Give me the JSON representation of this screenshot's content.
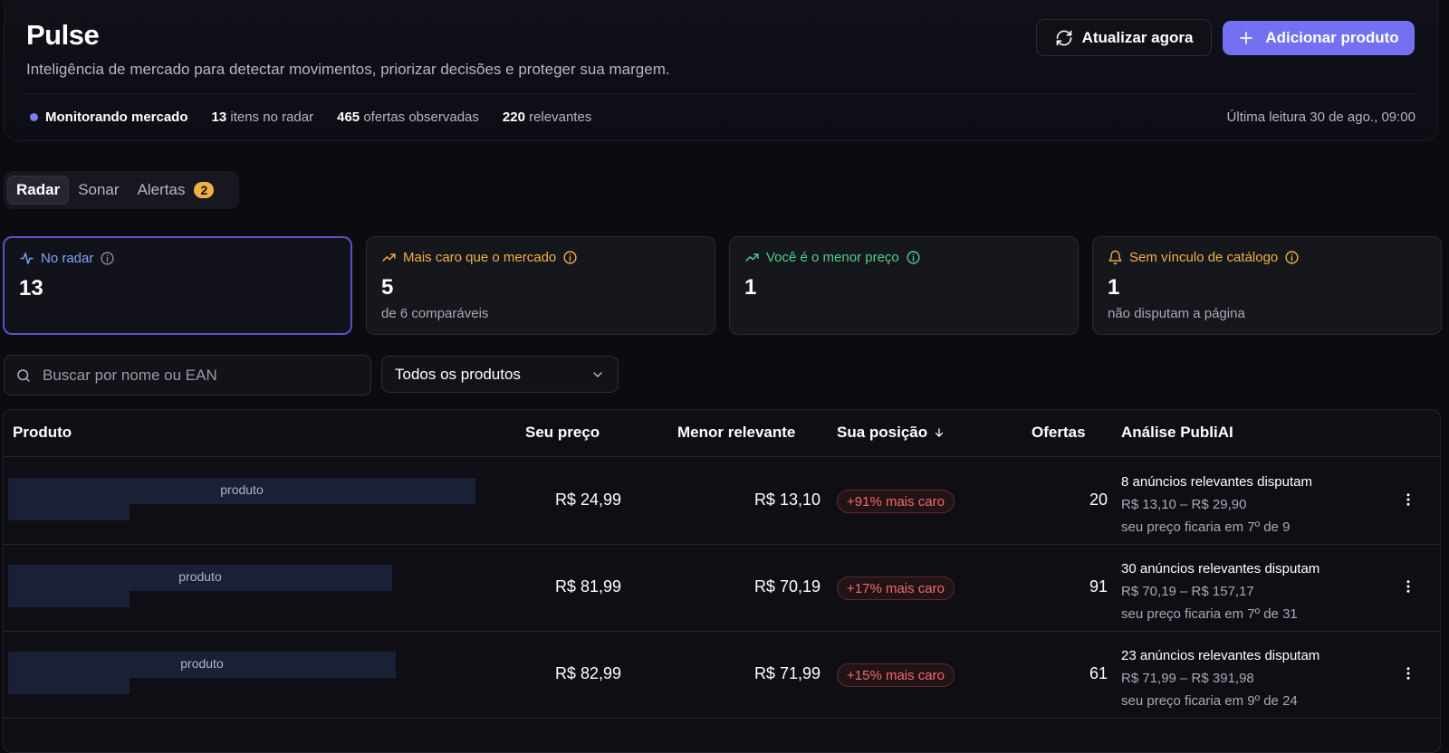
{
  "header": {
    "title": "Pulse",
    "subtitle": "Inteligência de mercado para detectar movimentos, priorizar decisões e proteger sua margem.",
    "refresh_label": "Atualizar agora",
    "add_label": "Adicionar produto",
    "status_label": "Monitorando mercado",
    "stats": [
      {
        "value": "13",
        "label": "itens no radar"
      },
      {
        "value": "465",
        "label": "ofertas observadas"
      },
      {
        "value": "220",
        "label": "relevantes"
      }
    ],
    "last_read": "Última leitura 30 de ago., 09:00"
  },
  "tabs": [
    {
      "label": "Radar"
    },
    {
      "label": "Sonar"
    },
    {
      "label": "Alertas",
      "badge": "2"
    }
  ],
  "cards": [
    {
      "label": "No radar",
      "value": "13",
      "sub": "",
      "color": "#7aa7f7",
      "icon": "activity-icon"
    },
    {
      "label": "Mais caro que o mercado",
      "value": "5",
      "sub": "de 6 comparáveis",
      "color": "#f1b045",
      "icon": "trending-up-icon"
    },
    {
      "label": "Você é o menor preço",
      "value": "1",
      "sub": "",
      "color": "#4fd08a",
      "icon": "trending-up-icon"
    },
    {
      "label": "Sem vínculo de catálogo",
      "value": "1",
      "sub": "não disputam a página",
      "color": "#f1b045",
      "icon": "bell-icon"
    }
  ],
  "filters": {
    "search_placeholder": "Buscar por nome ou EAN",
    "select_value": "Todos os produtos"
  },
  "table": {
    "headers": {
      "produto": "Produto",
      "seu_preco": "Seu preço",
      "menor": "Menor relevante",
      "posicao": "Sua posição",
      "ofertas": "Ofertas",
      "analise": "Análise PubliAI"
    },
    "rows": [
      {
        "produto": "produto",
        "seu_preco": "R$ 24,99",
        "menor": "R$ 13,10",
        "posicao": "+91% mais caro",
        "ofertas": "20",
        "a1": "8 anúncios relevantes disputam",
        "a2": "R$ 13,10 – R$ 29,90",
        "a3": "seu preço ficaria em 7º de 9"
      },
      {
        "produto": "produto",
        "seu_preco": "R$ 81,99",
        "menor": "R$ 70,19",
        "posicao": "+17% mais caro",
        "ofertas": "91",
        "a1": "30 anúncios relevantes disputam",
        "a2": "R$ 70,19 – R$ 157,17",
        "a3": "seu preço ficaria em 7º de 31"
      },
      {
        "produto": "produto",
        "seu_preco": "R$ 82,99",
        "menor": "R$ 71,99",
        "posicao": "+15% mais caro",
        "ofertas": "61",
        "a1": "23 anúncios relevantes disputam",
        "a2": "R$ 71,99 – R$ 391,98",
        "a3": "seu preço ficaria em 9º de 24"
      }
    ]
  }
}
